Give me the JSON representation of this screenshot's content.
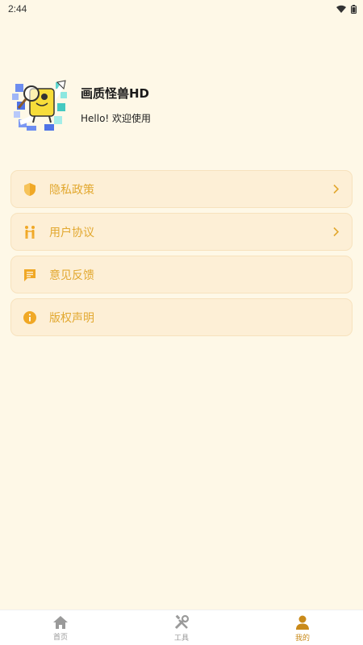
{
  "status_bar": {
    "time": "2:44"
  },
  "profile": {
    "app_name": "画质怪兽HD",
    "greeting": "Hello! 欢迎使用"
  },
  "menu": {
    "items": [
      {
        "label": "隐私政策",
        "icon": "shield-icon",
        "chevron": true
      },
      {
        "label": "用户协议",
        "icon": "users-icon",
        "chevron": true
      },
      {
        "label": "意见反馈",
        "icon": "message-icon",
        "chevron": false
      },
      {
        "label": "版权声明",
        "icon": "info-icon",
        "chevron": false
      }
    ]
  },
  "tabbar": {
    "tabs": [
      {
        "label": "首页",
        "icon": "home-icon",
        "active": false
      },
      {
        "label": "工具",
        "icon": "tools-icon",
        "active": false
      },
      {
        "label": "我的",
        "icon": "person-icon",
        "active": true
      }
    ]
  },
  "colors": {
    "background": "#fef8e7",
    "card": "#fdefd6",
    "accent": "#e2a830",
    "tab_active": "#c98a1a",
    "tab_inactive": "#999999"
  }
}
